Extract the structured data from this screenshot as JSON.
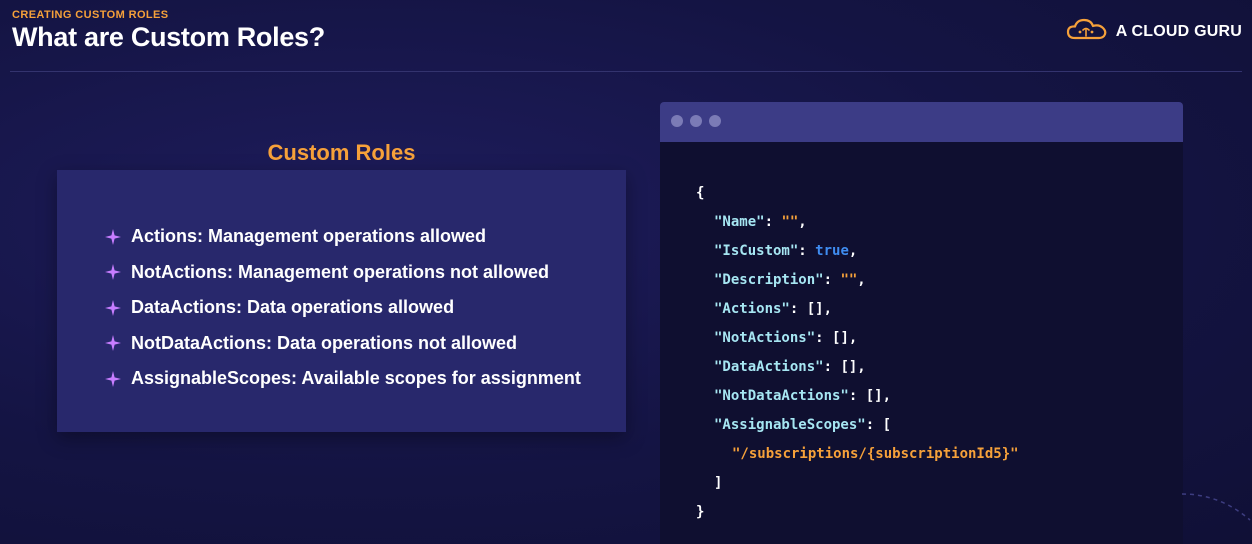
{
  "header": {
    "eyebrow": "CREATING CUSTOM ROLES",
    "title": "What are Custom Roles?",
    "brand": "A CLOUD GURU",
    "brand_icon": "cloud-logo-icon"
  },
  "left_panel": {
    "heading": "Custom Roles",
    "bullet_icon": "sparkle-icon",
    "items": [
      "Actions: Management operations allowed",
      "NotActions: Management operations not allowed",
      "DataActions: Data operations allowed",
      "NotDataActions: Data operations not allowed",
      "AssignableScopes: Available scopes for assignment"
    ]
  },
  "code_window": {
    "lines": [
      {
        "text": "{"
      },
      {
        "key": "\"Name\"",
        "sep": ": ",
        "value": "\"\"",
        "value_type": "string",
        "tail": ","
      },
      {
        "key": "\"IsCustom\"",
        "sep": ": ",
        "value": "true",
        "value_type": "keyword",
        "tail": ","
      },
      {
        "key": "\"Description\"",
        "sep": ": ",
        "value": "\"\"",
        "value_type": "string",
        "tail": ","
      },
      {
        "key": "\"Actions\"",
        "sep": ": ",
        "value": "[],",
        "value_type": "plain",
        "tail": ""
      },
      {
        "key": "\"NotActions\"",
        "sep": ": ",
        "value": "[],",
        "value_type": "plain",
        "tail": ""
      },
      {
        "key": "\"DataActions\"",
        "sep": ": ",
        "value": "[],",
        "value_type": "plain",
        "tail": ""
      },
      {
        "key": "\"NotDataActions\"",
        "sep": ": ",
        "value": "[],",
        "value_type": "plain",
        "tail": ""
      },
      {
        "key": "\"AssignableScopes\"",
        "sep": ": ",
        "value": "[",
        "value_type": "plain",
        "tail": ""
      },
      {
        "value": "\"/subscriptions/{subscriptionId5}\"",
        "value_type": "string"
      },
      {
        "text": "]"
      },
      {
        "text": "}"
      }
    ]
  },
  "colors": {
    "accent_orange": "#f6a13a",
    "background": "#141443",
    "card": "#28286c",
    "code_key": "#a6e6f2",
    "code_keyword": "#3f8cf0",
    "bullet": "#c77dff"
  }
}
